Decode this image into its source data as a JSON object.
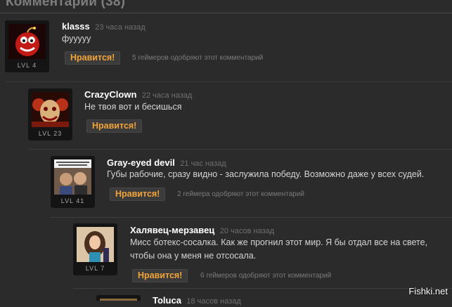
{
  "header": {
    "title": "Комментарии (38)"
  },
  "comments": [
    {
      "username": "klasss",
      "time": "23 часа назад",
      "text_lines": [
        "фууууу"
      ],
      "level": "LVL 4",
      "like_label": "Нравится!",
      "approve_text": "5 геймеров одобряют этот комментарий",
      "avatar": "bomb-avatar"
    },
    {
      "username": "CrazyClown",
      "time": "22 часа назад",
      "text_lines": [
        "Не твоя вот и бесишься"
      ],
      "level": "LVL 23",
      "like_label": "Нравится!",
      "approve_text": "",
      "avatar": "clown-avatar"
    },
    {
      "username": "Gray-eyed devil",
      "time": "21 час назад",
      "text_lines": [
        "Губы рабочие, сразу видно - заслужила победу. Возможно даже у всех судей."
      ],
      "level": "LVL 41",
      "like_label": "Нравится!",
      "approve_text": "2 геймера одобряют этот комментарий",
      "avatar": "meme-avatar"
    },
    {
      "username": "Халявец-мерзавец",
      "time": "20 часов назад",
      "text_lines": [
        "Мисс ботекс-сосалка. Как же прогнил этот мир. Я бы отдал все на свете,",
        "чтобы она у меня не отсосала."
      ],
      "level": "LVL 7",
      "like_label": "Нравится!",
      "approve_text": "6 геймеров одобряют этот комментарий",
      "avatar": "girl-avatar"
    },
    {
      "username": "Toluca",
      "time": "18 часов назад"
    }
  ],
  "watermark": "Fishki.net"
}
